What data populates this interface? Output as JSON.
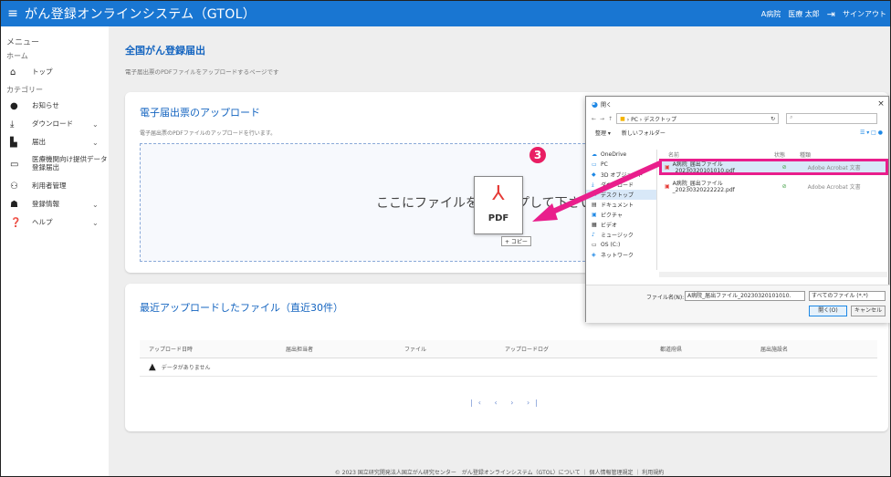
{
  "header": {
    "menu_icon": "hamburger-icon",
    "title": "がん登録オンラインシステム（GTOL）",
    "hospital": "A病院",
    "user": "医療 太郎",
    "signout": "サインアウト"
  },
  "sidebar": {
    "heading": "メニュー",
    "home_label": "ホーム",
    "category_label": "カテゴリー",
    "items": [
      {
        "label": "トップ",
        "icon": "home-icon"
      },
      {
        "label": "お知らせ",
        "icon": "info-icon"
      },
      {
        "label": "ダウンロード",
        "icon": "download-icon",
        "chevron": "⌄"
      },
      {
        "label": "届出",
        "icon": "document-icon",
        "chevron": "⌄"
      },
      {
        "label": "医療機関向け提供データ登録届出",
        "icon": "monitor-icon"
      },
      {
        "label": "利用者管理",
        "icon": "users-icon"
      },
      {
        "label": "登録情報",
        "icon": "user-settings-icon",
        "chevron": "⌄"
      },
      {
        "label": "ヘルプ",
        "icon": "help-icon",
        "chevron": "⌄"
      }
    ]
  },
  "main": {
    "title": "全国がん登録届出",
    "subtitle": "電子届出票のPDFファイルをアップロードするページです",
    "upload": {
      "heading": "電子届出票のアップロード",
      "desc": "電子届出票のPDFファイルのアップロードを行います。",
      "drop_text": "ここにファイルをドロップして下さい",
      "drag_icon_text": "PDF",
      "copy_badge": "+ コピー",
      "step": "3"
    },
    "recent": {
      "heading": "最近アップロードしたファイル（直近30件）",
      "columns": [
        "アップロード日時",
        "届出担当者",
        "ファイル",
        "アップロードログ",
        "都道府県",
        "届出施設名"
      ],
      "empty": "データがありません",
      "pager": [
        "|‹",
        "‹",
        "›",
        "›|"
      ]
    },
    "footer": "© 2023 国立研究開発法人国立がん研究センター　がん登録オンラインシステム（GTOL）について ｜ 個人情報管理規定 ｜ 利用規約"
  },
  "dialog": {
    "title": "開く",
    "close": "×",
    "path": "› PC › デスクトップ",
    "search_placeholder": "",
    "toolbar": {
      "organize": "整理 ▾",
      "new_folder": "新しいフォルダー"
    },
    "nav": [
      {
        "label": "OneDrive",
        "icon": "cloud-icon"
      },
      {
        "label": "PC",
        "icon": "pc-icon"
      },
      {
        "label": "3D オブジェクト",
        "icon": "cube-icon"
      },
      {
        "label": "ダウンロード",
        "icon": "download-icon"
      },
      {
        "label": "デスクトップ",
        "icon": "desktop-icon",
        "selected": true
      },
      {
        "label": "ドキュメント",
        "icon": "doc-icon"
      },
      {
        "label": "ピクチャ",
        "icon": "picture-icon"
      },
      {
        "label": "ビデオ",
        "icon": "video-icon"
      },
      {
        "label": "ミュージック",
        "icon": "music-icon"
      },
      {
        "label": "OS (C:)",
        "icon": "drive-icon"
      },
      {
        "label": "ネットワーク",
        "icon": "network-icon"
      }
    ],
    "columns": {
      "name": "名前",
      "status": "状態",
      "type": "種類"
    },
    "files": [
      {
        "name": "A病院_届出ファイル_20230320101010.pdf",
        "status": "⊘",
        "type": "Adobe Acrobat 文書"
      },
      {
        "name": "A病院_届出ファイル_20230320222222.pdf",
        "status": "⊘",
        "type": "Adobe Acrobat 文書"
      }
    ],
    "filename_label": "ファイル名(N):",
    "filename_value": "A病院_届出ファイル_20230320101010.",
    "filetype": "すべてのファイル (*.*)",
    "open": "開く(O)",
    "cancel": "キャンセル"
  },
  "colors": {
    "accent": "#1976d2",
    "highlight": "#e91e8c",
    "arrow": "#e91e8c"
  }
}
